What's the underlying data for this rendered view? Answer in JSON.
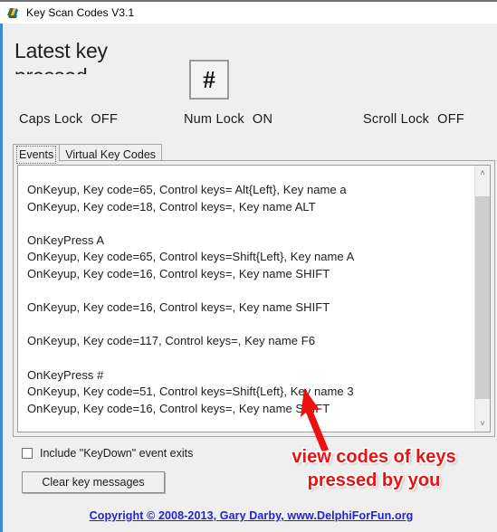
{
  "window": {
    "title": "Key Scan Codes V3.1",
    "icon": "app-icon",
    "accent_border": "#3f8ccb",
    "background": "#efefef"
  },
  "header": {
    "latest_key_label": "Latest key\npressed",
    "latest_key_value": "#"
  },
  "lock_status": [
    {
      "name": "Caps Lock",
      "state": "OFF"
    },
    {
      "name": "Num Lock",
      "state": "ON"
    },
    {
      "name": "Scroll Lock",
      "state": "OFF"
    }
  ],
  "tabs": [
    {
      "label": "Events",
      "selected": true
    },
    {
      "label": "Virtual Key Codes",
      "selected": false
    }
  ],
  "log": {
    "lines": [
      "OnKeyup, Key code=65, Control keys= Alt{Left}, Key name a",
      "OnKeyup, Key code=18, Control keys=, Key name ALT",
      "",
      "OnKeyPress A",
      "OnKeyup, Key code=65, Control keys=Shift{Left}, Key name A",
      "OnKeyup, Key code=16, Control keys=, Key name SHIFT",
      "",
      "OnKeyup, Key code=16, Control keys=, Key name SHIFT",
      "",
      "OnKeyup, Key code=117, Control keys=, Key name F6",
      "",
      "OnKeyPress #",
      "OnKeyup, Key code=51, Control keys=Shift{Left}, Key name 3",
      "OnKeyup, Key code=16, Control keys=, Key name SHIFT"
    ],
    "scrollbar": {
      "up_arrow": "˄",
      "down_arrow": "˅"
    }
  },
  "controls": {
    "include_keydown_label": "Include \"KeyDown\" event exits",
    "include_keydown_checked": false,
    "clear_button_label": "Clear key messages"
  },
  "annotation": {
    "text": "view codes of keys\npressed by you",
    "color": "#ee1111"
  },
  "footer": {
    "copyright": "Copyright © 2008-2013, Gary Darby,  www.DelphiForFun.org",
    "link_color": "#2222dd"
  }
}
